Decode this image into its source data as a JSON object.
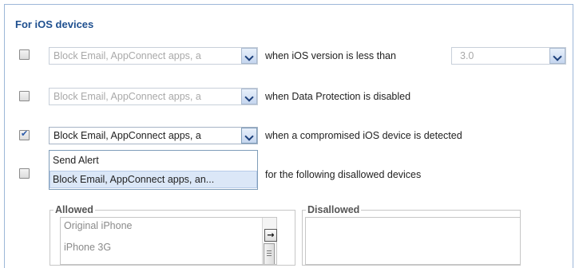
{
  "section": {
    "title": "For iOS devices"
  },
  "rows": [
    {
      "checked": false,
      "action_value": "Block Email, AppConnect apps, a",
      "condition": "when iOS version is less than",
      "version_value": "3.0"
    },
    {
      "checked": false,
      "action_value": "Block Email, AppConnect apps, a",
      "condition": "when Data Protection is disabled"
    },
    {
      "checked": true,
      "action_value": "Block Email, AppConnect apps, a",
      "condition": "when a compromised iOS device is detected"
    },
    {
      "checked": false,
      "condition": "for the following disallowed devices"
    }
  ],
  "dropdown": {
    "options": [
      "Send Alert",
      "Block Email, AppConnect apps, an..."
    ],
    "highlighted_index": 1
  },
  "allowed": {
    "legend": "Allowed",
    "items": [
      "Original iPhone",
      "iPhone 3G"
    ]
  },
  "move_button": {
    "icon": "arrow-right-icon",
    "glyph": "→"
  },
  "disallowed": {
    "legend": "Disallowed",
    "items": []
  },
  "colors": {
    "title": "#1e4f8f",
    "panel_border": "#9db7d8",
    "highlight": "#dbe7f7"
  }
}
